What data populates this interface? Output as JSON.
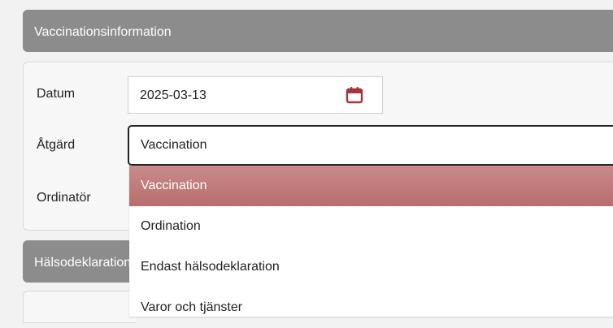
{
  "vaccination_panel": {
    "title": "Vaccinationsinformation",
    "date_label": "Datum",
    "date_value": "2025-03-13",
    "action_label": "Åtgärd",
    "action_value": "Vaccination",
    "prescriber_label": "Ordinatör"
  },
  "action_dropdown": {
    "options": [
      "Vaccination",
      "Ordination",
      "Endast hälsodeklaration",
      "Varor och tjänster"
    ],
    "selected_index": 0
  },
  "health_panel": {
    "title": "Hälsodeklaration"
  },
  "colors": {
    "header_bg": "#8c8c8c",
    "selected_option_bg": "#c07c7c",
    "calendar_icon": "#a8323c"
  },
  "icons": [
    "calendar-icon"
  ]
}
